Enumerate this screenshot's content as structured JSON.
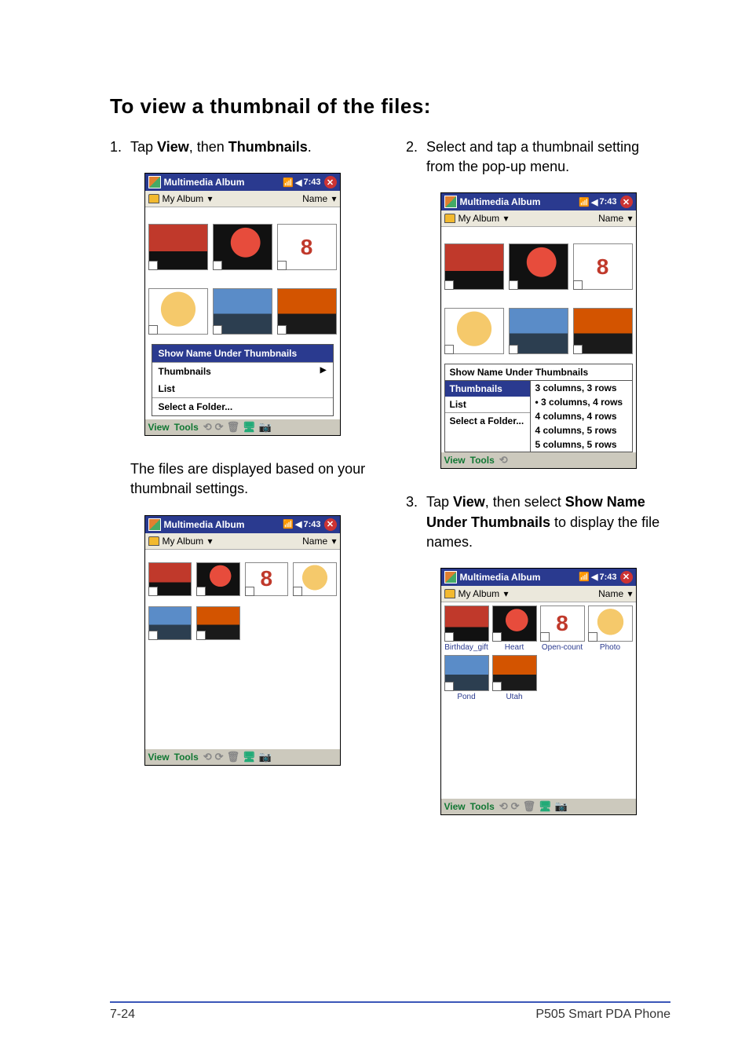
{
  "section_title": "To view a thumbnail of the files:",
  "steps": {
    "s1_num": "1.",
    "s1_a": "Tap ",
    "s1_b1": "View",
    "s1_c": ", then ",
    "s1_b2": "Thumbnails",
    "s1_d": ".",
    "s2_num": "2.",
    "s2_text": "Select and tap a thumbnail setting from the pop-up menu.",
    "p1": "The files are displayed based on your thumbnail settings.",
    "s3_num": "3.",
    "s3_a": "Tap ",
    "s3_b1": "View",
    "s3_c": ", then select ",
    "s3_b2": "Show Name Under Thumbnails",
    "s3_d": " to display the file names."
  },
  "pda": {
    "title": "Multimedia Album",
    "time": "7:43",
    "album": "My Album",
    "sort": "Name",
    "menu": {
      "show_name": "Show Name Under Thumbnails",
      "thumbnails": "Thumbnails",
      "list": "List",
      "select_folder": "Select a Folder..."
    },
    "submenu": {
      "o1": "3 columns, 3 rows",
      "o2": "3 columns, 4 rows",
      "o3": "4 columns, 4 rows",
      "o4": "4 columns, 5 rows",
      "o5": "5 columns, 5 rows"
    },
    "bottom": {
      "view": "View",
      "tools": "Tools"
    },
    "labels": {
      "l1": "Birthday_gift",
      "l2": "Heart",
      "l3": "Open-count",
      "l4": "Photo",
      "l5": "Pond",
      "l6": "Utah"
    },
    "eight": "8"
  },
  "footer": {
    "left": "7-24",
    "right": "P505 Smart PDA Phone"
  }
}
